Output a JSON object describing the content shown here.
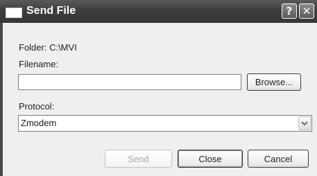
{
  "window": {
    "title": "Send File",
    "help_glyph": "?",
    "close_glyph": "✕"
  },
  "folder": {
    "label": "Folder:  C:\\MVI"
  },
  "filename": {
    "label": "Filename:",
    "value": "",
    "browse_label": "Browse..."
  },
  "protocol": {
    "label": "Protocol:",
    "selected": "Zmodem"
  },
  "actions": {
    "send_label": "Send",
    "close_label": "Close",
    "cancel_label": "Cancel"
  },
  "icons": {
    "window_icon": "window-icon",
    "help": "help-icon",
    "close": "close-icon",
    "dropdown": "chevron-down-icon"
  },
  "colors": {
    "titlebar": "#3e3e3e",
    "dialog_bg": "#efefef",
    "disabled_text": "#a9a9a9"
  }
}
